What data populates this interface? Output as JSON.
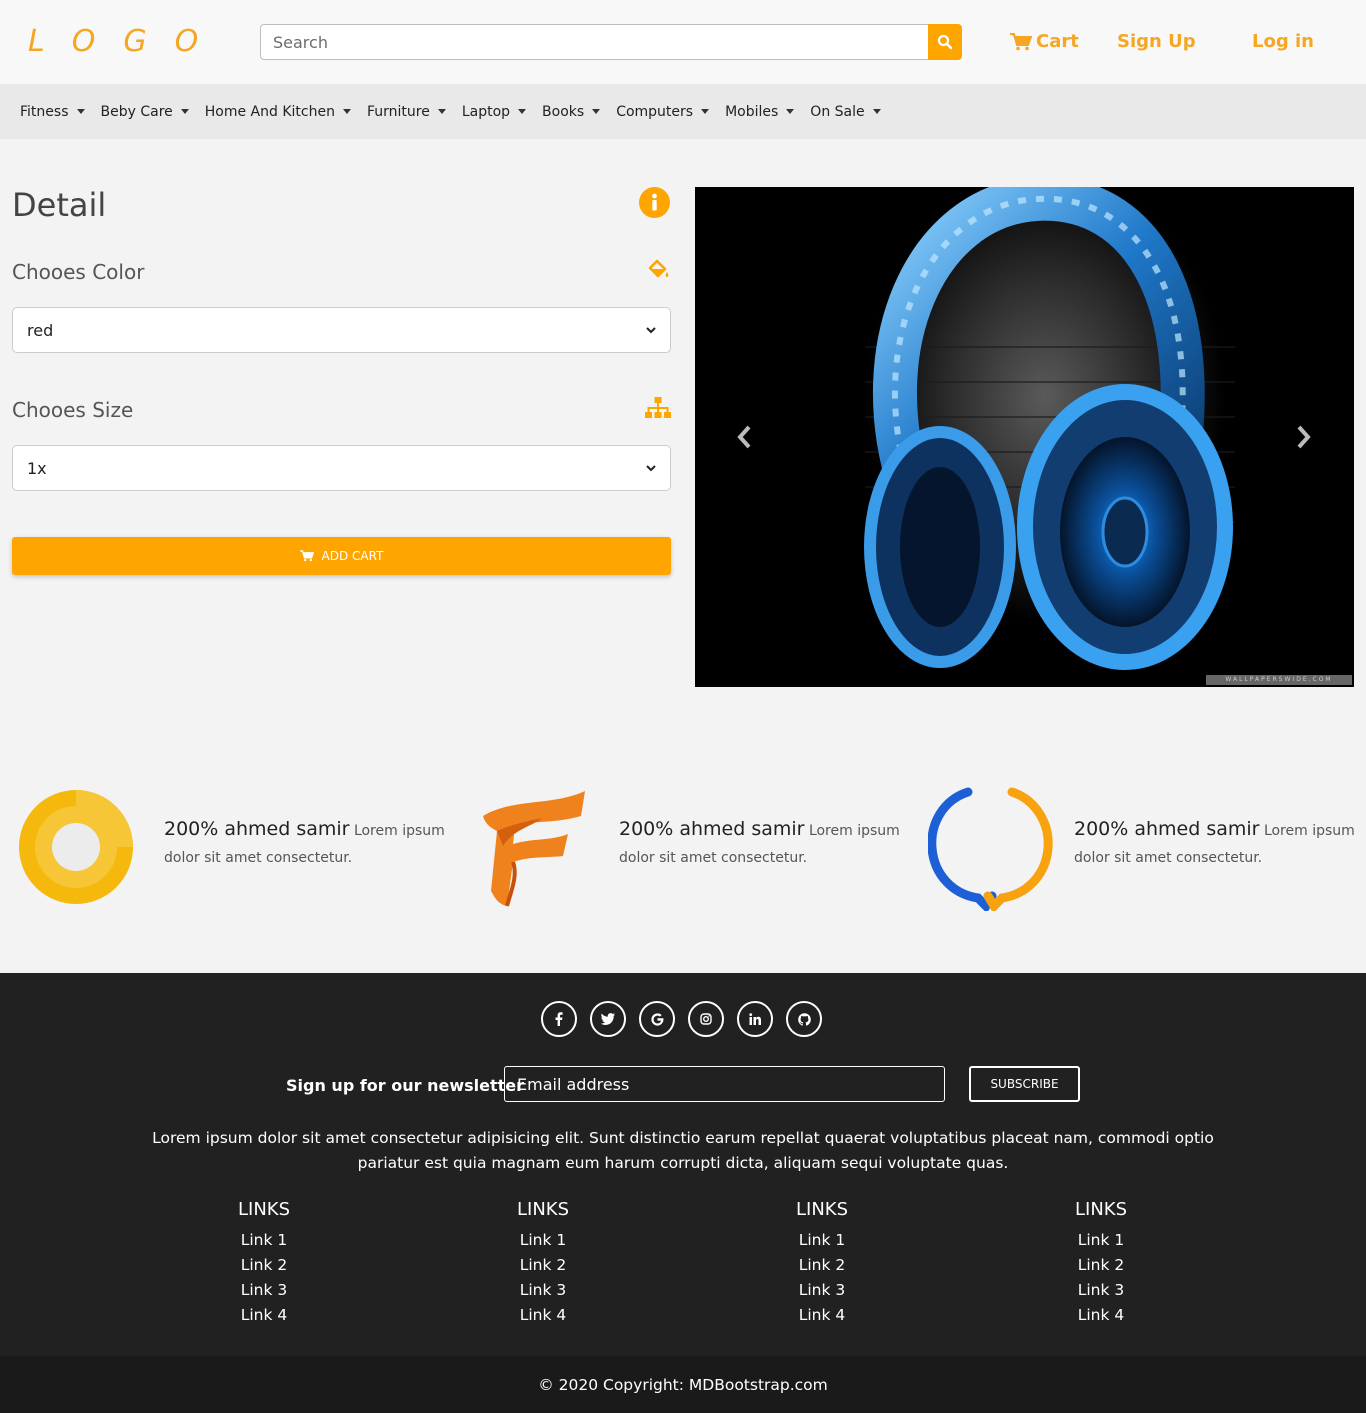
{
  "header": {
    "logo": "LOGO",
    "search_placeholder": "Search",
    "cart_label": "Cart",
    "signup_label": "Sign Up",
    "login_label": "Log in"
  },
  "nav": {
    "items": [
      {
        "label": "Fitness"
      },
      {
        "label": "Beby Care"
      },
      {
        "label": "Home And Kitchen"
      },
      {
        "label": "Furniture"
      },
      {
        "label": "Laptop"
      },
      {
        "label": "Books"
      },
      {
        "label": "Computers"
      },
      {
        "label": "Mobiles"
      },
      {
        "label": "On Sale"
      }
    ]
  },
  "detail": {
    "title": "Detail",
    "color_label": "Chooes Color",
    "color_value": "red",
    "size_label": "Chooes Size",
    "size_value": "1x",
    "add_cart_label": "ADD CART"
  },
  "carousel": {
    "watermark": "WALLPAPERSWIDE.COM"
  },
  "features": [
    {
      "strong": "200% ahmed samir",
      "text": "Lorem ipsum dolor sit amet consectetur."
    },
    {
      "strong": "200% ahmed samir",
      "text": "Lorem ipsum dolor sit amet consectetur."
    },
    {
      "strong": "200% ahmed samir",
      "text": "Lorem ipsum dolor sit amet consectetur."
    }
  ],
  "footer": {
    "socials": [
      "facebook-icon",
      "twitter-icon",
      "google-icon",
      "instagram-icon",
      "linkedin-icon",
      "github-icon"
    ],
    "newsletter_label": "Sign up for our newsletter",
    "email_placeholder": "Email address",
    "subscribe_label": "SUBSCRIBE",
    "lorem": "Lorem ipsum dolor sit amet consectetur adipisicing elit. Sunt distinctio earum repellat quaerat voluptatibus placeat nam, commodi optio pariatur est quia magnam eum harum corrupti dicta, aliquam sequi voluptate quas.",
    "link_columns": [
      {
        "title": "LINKS",
        "links": [
          "Link 1",
          "Link 2",
          "Link 3",
          "Link 4"
        ]
      },
      {
        "title": "LINKS",
        "links": [
          "Link 1",
          "Link 2",
          "Link 3",
          "Link 4"
        ]
      },
      {
        "title": "LINKS",
        "links": [
          "Link 1",
          "Link 2",
          "Link 3",
          "Link 4"
        ]
      },
      {
        "title": "LINKS",
        "links": [
          "Link 1",
          "Link 2",
          "Link 3",
          "Link 4"
        ]
      }
    ],
    "copyright": "© 2020 Copyright: MDBootstrap.com"
  },
  "colors": {
    "accent": "#ffa500",
    "footer_bg": "#212121"
  }
}
